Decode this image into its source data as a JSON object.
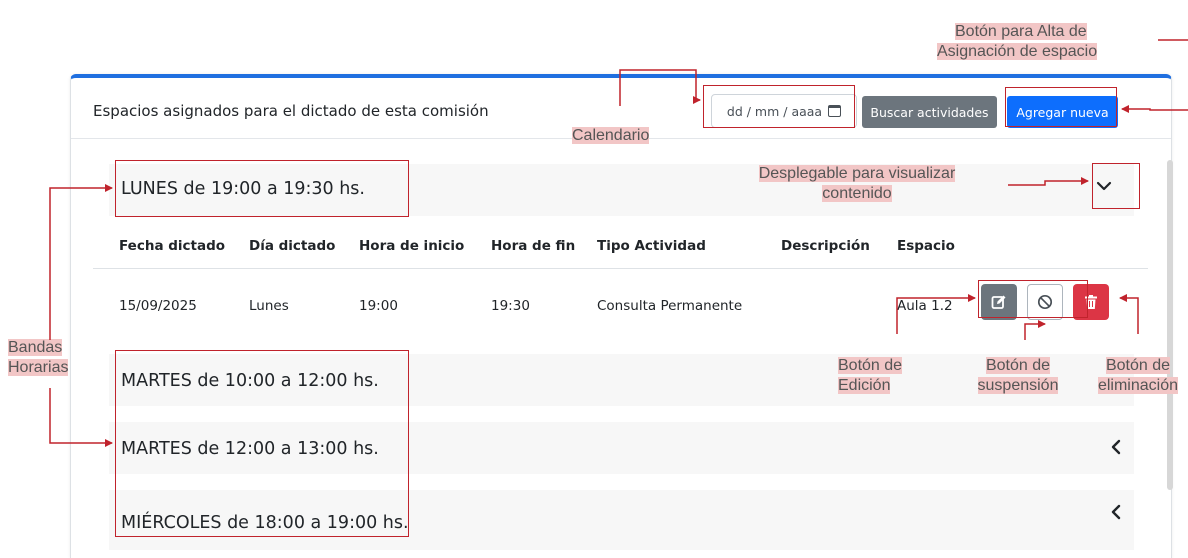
{
  "card": {
    "title": "Espacios asignados para el dictado de esta comisión",
    "date_placeholder": "dd / mm / aaaa",
    "search_button": "Buscar actividades",
    "add_button": "Agregar nueva"
  },
  "bands": [
    {
      "label": "LUNES de 19:00 a 19:30 hs.",
      "expanded": true
    },
    {
      "label": "MARTES de 10:00 a 12:00 hs.",
      "expanded": false
    },
    {
      "label": "MARTES de 12:00 a 13:00 hs.",
      "expanded": false
    },
    {
      "label": "MIÉRCOLES de 18:00 a 19:00 hs.",
      "expanded": false
    }
  ],
  "table": {
    "headers": [
      "Fecha dictado",
      "Día dictado",
      "Hora de inicio",
      "Hora de fin",
      "Tipo Actividad",
      "Descripción",
      "Espacio"
    ],
    "rows": [
      [
        "15/09/2025",
        "Lunes",
        "19:00",
        "19:30",
        "Consulta Permanente",
        "",
        "Aula 1.2"
      ]
    ]
  },
  "annotations": {
    "alta_line1": "Botón para Alta de",
    "alta_line2": "Asignación de espacio",
    "calendario": "Calendario",
    "desplegable_line1": "Desplegable para visualizar",
    "desplegable_line2": "contenido",
    "bandas_line1": "Bandas",
    "bandas_line2": "Horarias",
    "edicion_line1": "Botón de",
    "edicion_line2": "Edición",
    "suspension_line1": "Botón de",
    "suspension_line2": "suspensión",
    "eliminacion_line1": "Botón de",
    "eliminacion_line2": "eliminación"
  },
  "icons": {
    "expand": "chevron-down-icon",
    "collapsed": "chevron-left-icon",
    "calendar": "calendar-icon",
    "edit": "edit-icon",
    "suspend": "ban-icon",
    "delete": "trash-icon"
  },
  "colors": {
    "accent": "#1f6fe0",
    "annotation_red": "#c0232c",
    "annotation_highlight": "#f2c6c6",
    "delete_button": "#dc3545",
    "secondary_button": "#6c757d"
  }
}
